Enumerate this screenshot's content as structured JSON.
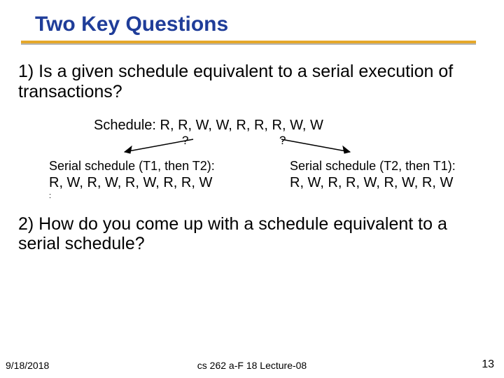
{
  "title": "Two Key Questions",
  "question1": "1) Is a given schedule equivalent to a serial execution of transactions?",
  "question2": "2) How do you come up with a schedule equivalent to a serial schedule?",
  "schedule": {
    "prefix": "Schedule:",
    "sequence": "R, R, W, W, R, R, R, W, W"
  },
  "qmark_glyph": "?",
  "serial_left": {
    "label": "Serial schedule (T1, then T2):",
    "sequence": "R, W, R, W, R, W, R, R, W",
    "trailing": ":"
  },
  "serial_right": {
    "label": "Serial schedule (T2, then T1):",
    "sequence": "R, W, R, R, W, R, W, R, W"
  },
  "footer": {
    "date": "9/18/2018",
    "center": "cs 262 a-F 18 Lecture-08",
    "page": "13"
  }
}
